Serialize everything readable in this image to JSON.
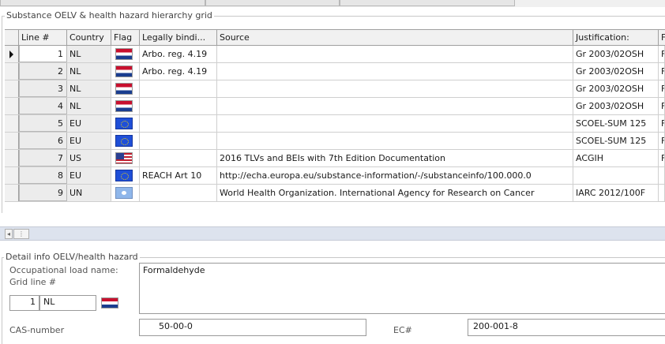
{
  "grid_title": "Substance OELV & health hazard hierarchy grid",
  "columns": [
    "Line #",
    "Country",
    "Flag",
    "Legally bindi...",
    "Source",
    "Justification:",
    "F"
  ],
  "rows": [
    {
      "line": "1",
      "country": "NL",
      "flag": "nl-flag-icon",
      "legal": "Arbo. reg. 4.19",
      "source": "",
      "justification": "Gr 2003/02OSH",
      "extra": "F",
      "current": true
    },
    {
      "line": "2",
      "country": "NL",
      "flag": "nl-flag-icon",
      "legal": "Arbo. reg. 4.19",
      "source": "",
      "justification": "Gr 2003/02OSH",
      "extra": "F",
      "current": false
    },
    {
      "line": "3",
      "country": "NL",
      "flag": "nl-flag-icon",
      "legal": "",
      "source": "",
      "justification": "Gr 2003/02OSH",
      "extra": "F",
      "current": false
    },
    {
      "line": "4",
      "country": "NL",
      "flag": "nl-flag-icon",
      "legal": "",
      "source": "",
      "justification": "Gr 2003/02OSH",
      "extra": "F",
      "current": false
    },
    {
      "line": "5",
      "country": "EU",
      "flag": "eu-flag-icon",
      "legal": "",
      "source": "",
      "justification": "SCOEL-SUM 125",
      "extra": "F",
      "current": false
    },
    {
      "line": "6",
      "country": "EU",
      "flag": "eu-flag-icon",
      "legal": "",
      "source": "",
      "justification": "SCOEL-SUM 125",
      "extra": "F",
      "current": false
    },
    {
      "line": "7",
      "country": "US",
      "flag": "us-flag-icon",
      "legal": "",
      "source": "2016 TLVs and BEIs with 7th Edition Documentation",
      "justification": "ACGIH",
      "extra": "F",
      "current": false
    },
    {
      "line": "8",
      "country": "EU",
      "flag": "eu-flag-icon",
      "legal": "REACH Art 10",
      "source": "http://echa.europa.eu/substance-information/-/substanceinfo/100.000.0",
      "justification": "",
      "extra": "",
      "current": false
    },
    {
      "line": "9",
      "country": "UN",
      "flag": "un-flag-icon",
      "legal": "",
      "source": "World Health Organization. International Agency for Research on Cancer",
      "justification": "IARC 2012/100F",
      "extra": "",
      "current": false
    }
  ],
  "scrollbar": {
    "left_arrow": "◂",
    "grip": "⋮"
  },
  "detail": {
    "title": "Detail info OELV/health hazard",
    "occ_label": "Occupational load name:",
    "occ_value": "Formaldehyde",
    "grid_line_label": "Grid line #",
    "grid_line_value": "1",
    "grid_country_value": "NL",
    "grid_flag": "nl-flag-icon",
    "cas_label": "CAS-number",
    "cas_value": "50-00-0",
    "ec_label": "EC#",
    "ec_value": "200-001-8"
  }
}
